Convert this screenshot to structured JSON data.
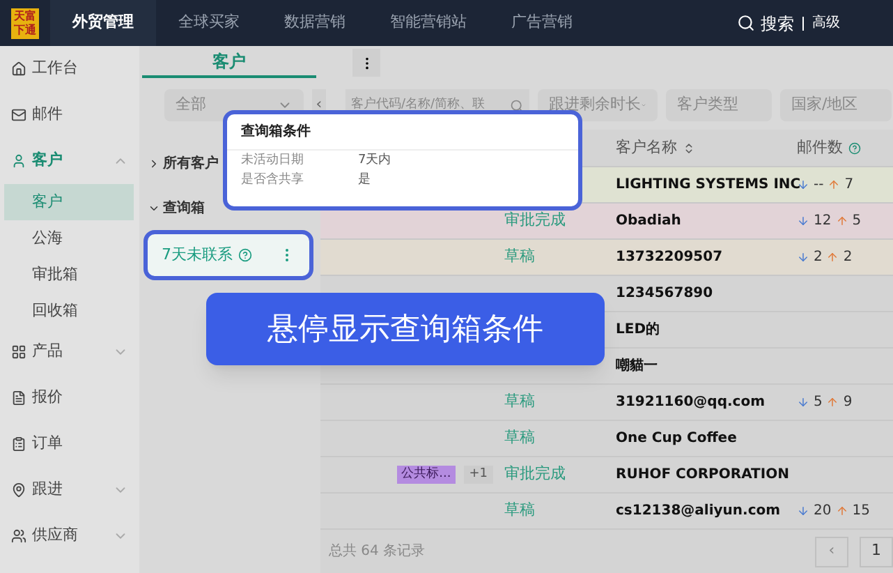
{
  "top_nav": {
    "logo": "天富下通",
    "items": [
      {
        "label": "外贸管理",
        "selected": true
      },
      {
        "label": "全球买家",
        "selected": false
      },
      {
        "label": "数据营销",
        "selected": false
      },
      {
        "label": "智能营销站",
        "selected": false
      },
      {
        "label": "广告营销",
        "selected": false
      }
    ],
    "search": "搜索",
    "advanced": "高级"
  },
  "sidebar": {
    "items": [
      {
        "label": "工作台",
        "selected": false
      },
      {
        "label": "邮件",
        "selected": false
      },
      {
        "label": "客户",
        "expanded": true,
        "selected": true,
        "children": [
          {
            "label": "客户",
            "selected": true
          },
          {
            "label": "公海",
            "selected": false
          },
          {
            "label": "审批箱",
            "selected": false
          },
          {
            "label": "回收箱",
            "selected": false
          }
        ]
      },
      {
        "label": "产品",
        "expanded": false,
        "selected": false
      },
      {
        "label": "报价",
        "selected": false
      },
      {
        "label": "订单",
        "selected": false
      },
      {
        "label": "跟进",
        "expanded": false,
        "selected": false
      },
      {
        "label": "供应商",
        "expanded": false,
        "selected": false
      }
    ]
  },
  "tab": {
    "label": "客户"
  },
  "filters": {
    "scope": "全部",
    "collapse": "‹",
    "search_placeholder": "客户代码/名称/简称、联",
    "followup": "跟进剩余时长",
    "type": "客户类型",
    "country": "国家/地区"
  },
  "panel": {
    "groups": [
      {
        "label": "所有客户",
        "expanded": false
      },
      {
        "label": "查询箱",
        "expanded": true
      }
    ],
    "query_item": "7天未联系"
  },
  "popover": {
    "title": "查询箱条件",
    "rows": [
      {
        "label": "未活动日期",
        "value": "7天内"
      },
      {
        "label": "是否含共享",
        "value": "是"
      }
    ]
  },
  "banner": "悬停显示查询箱条件",
  "table": {
    "columns": [
      "客户名称",
      "邮件数"
    ],
    "rows": [
      {
        "name": "LIGHTING SYSTEMS INC",
        "status": null,
        "color": "#dfe2d2",
        "mail_in": "--",
        "mail_out": "7"
      },
      {
        "name": "Obadiah",
        "status": "审批完成",
        "color": "#e2d3d7",
        "mail_in": "12",
        "mail_out": "5"
      },
      {
        "name": "13732209507",
        "status": "草稿",
        "color": "#e1dbd0",
        "mail_in": "2",
        "mail_out": "2"
      },
      {
        "name": "1234567890",
        "status": null,
        "color": null
      },
      {
        "name": "LED的",
        "status": null,
        "color": null
      },
      {
        "name": "嘲貓一",
        "status": null,
        "color": null
      },
      {
        "name": "31921160@qq.com",
        "status": "草稿",
        "color": null,
        "mail_in": "5",
        "mail_out": "9"
      },
      {
        "name": "One Cup Coffee",
        "status": "草稿",
        "color": null
      },
      {
        "name": "RUHOF CORPORATION",
        "status": "审批完成",
        "color": null,
        "tag": "公共标...",
        "tag_more": "+1"
      },
      {
        "name": "cs12138@aliyun.com",
        "status": "草稿",
        "color": null,
        "mail_in": "20",
        "mail_out": "15"
      }
    ]
  },
  "footer": {
    "total": "总共 64 条记录",
    "page": "1",
    "prev": "‹"
  }
}
